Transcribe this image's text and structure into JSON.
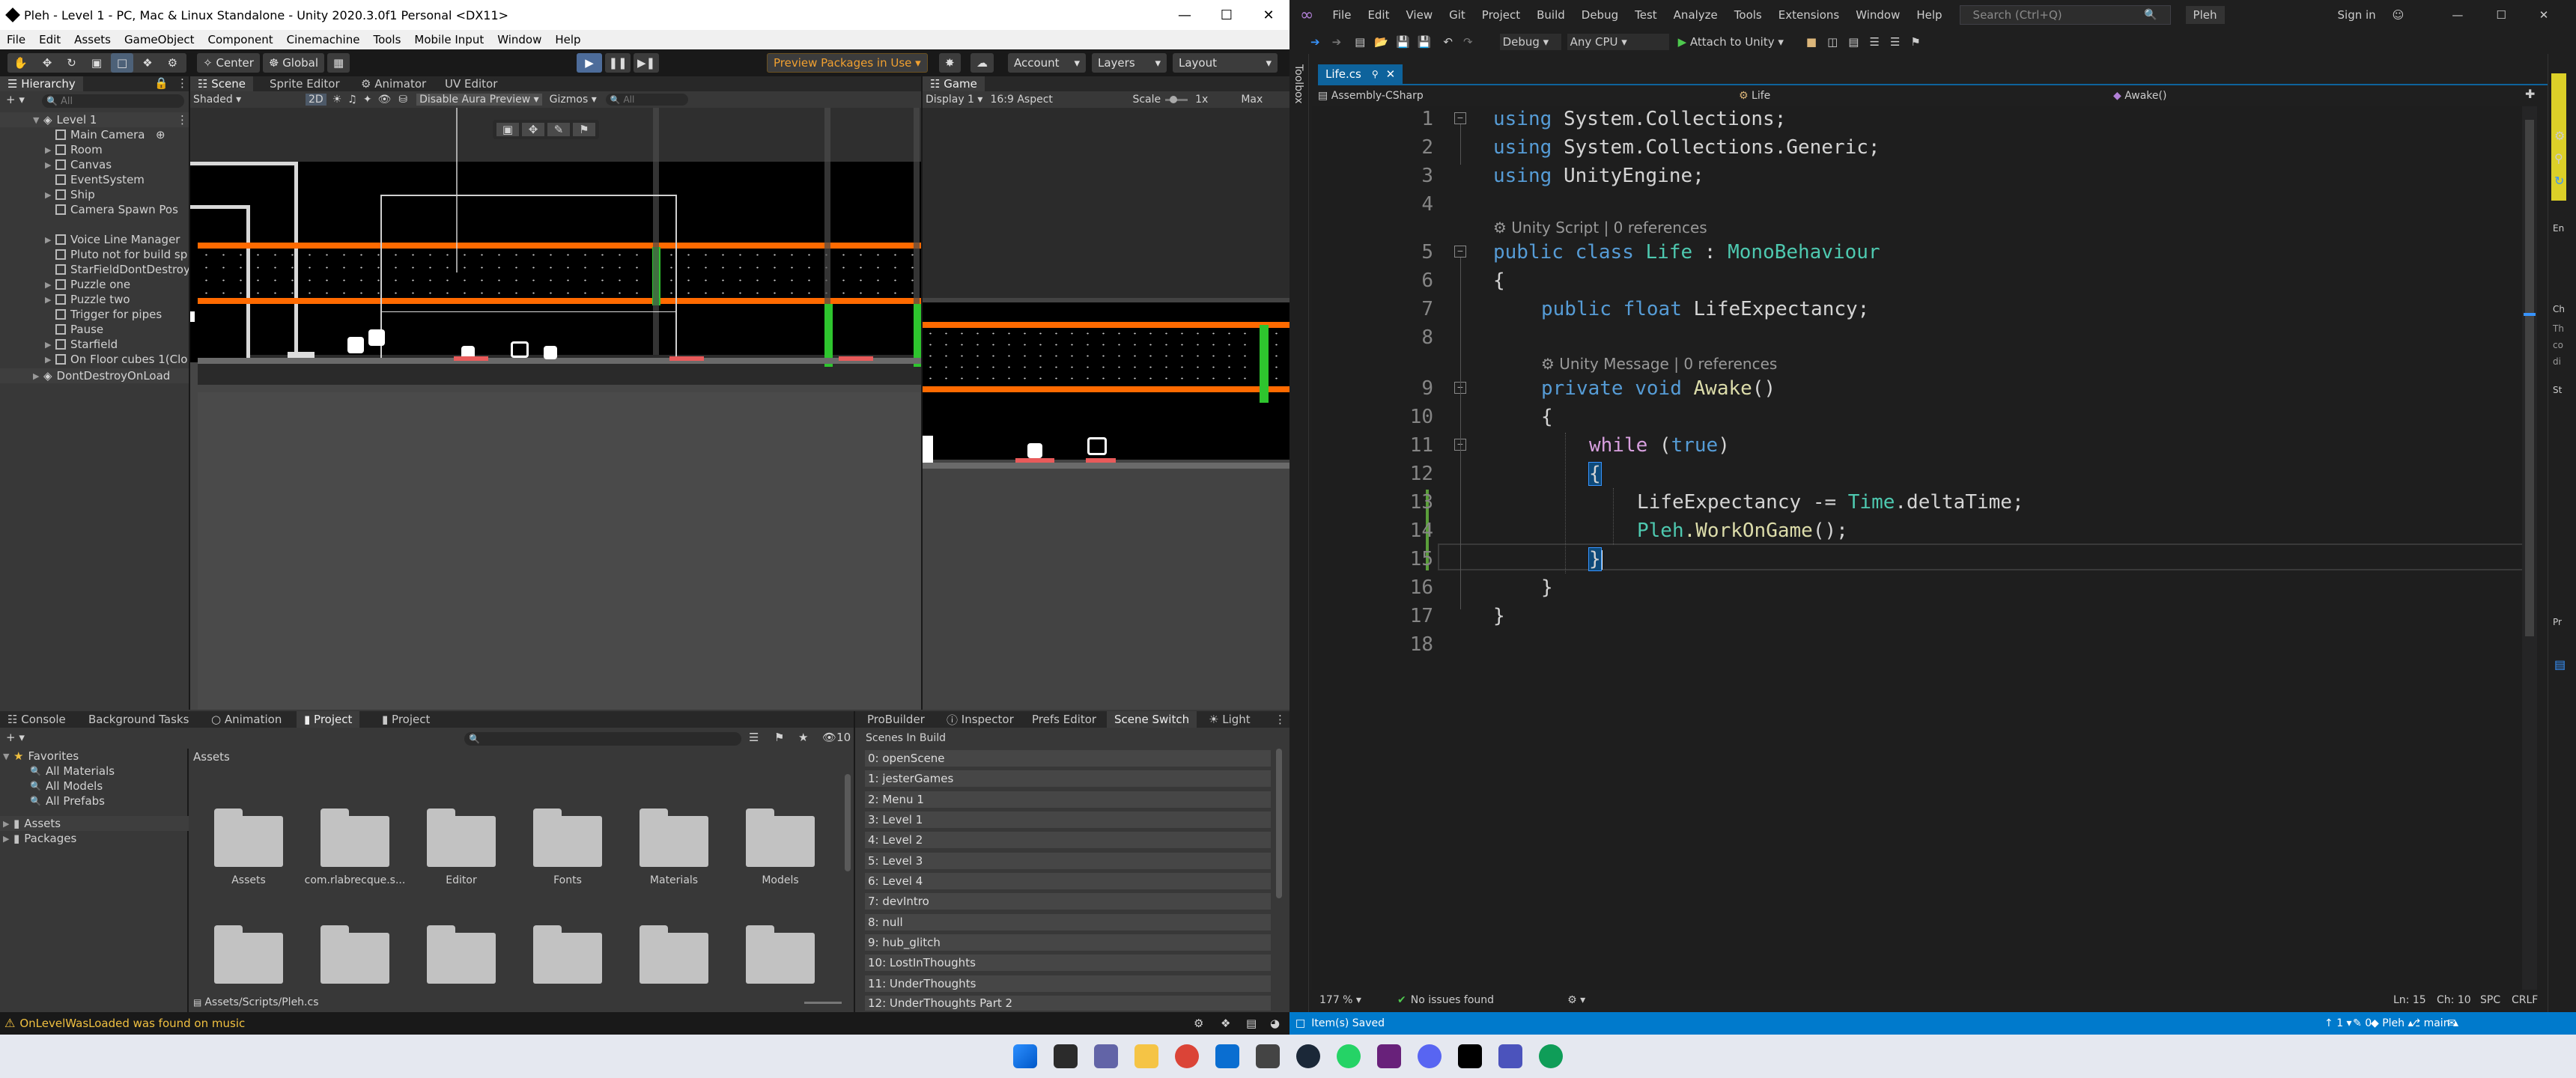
{
  "unity": {
    "title": "Pleh - Level 1 - PC, Mac & Linux Standalone - Unity 2020.3.0f1 Personal <DX11>",
    "menu": [
      "File",
      "Edit",
      "Assets",
      "GameObject",
      "Component",
      "Cinemachine",
      "Tools",
      "Mobile Input",
      "Window",
      "Help"
    ],
    "toolbar": {
      "center": "Center",
      "global": "Global",
      "packages": "Preview Packages in Use ▾",
      "account": "Account",
      "layers": "Layers",
      "layout": "Layout"
    },
    "hierarchy": {
      "tab": "Hierarchy",
      "search": "All",
      "items": [
        "Level 1",
        "Main Camera",
        "Room",
        "Canvas",
        "EventSystem",
        "Ship",
        "Camera Spawn Pos",
        "Voice Line Manager",
        "Pluto not for build sp",
        "StarFieldDontDestroy",
        "Puzzle one",
        "Puzzle two",
        "Trigger for pipes",
        "Pause",
        "Starfield",
        "On Floor cubes 1(Clo",
        "DontDestroyOnLoad"
      ]
    },
    "scene_tabs": [
      "Scene",
      "Sprite Editor",
      "Animator",
      "UV Editor"
    ],
    "scene_bar": {
      "shaded": "Shaded",
      "mode2d": "2D",
      "aura": "Disable Aura Preview",
      "gizmos": "Gizmos",
      "search": "All"
    },
    "game": {
      "tab": "Game",
      "display": "Display 1",
      "aspect": "16:9 Aspect",
      "scale": "Scale",
      "scale_val": "1x",
      "max": "Max"
    },
    "bottom_tabs": [
      "Console",
      "Background Tasks",
      "Animation",
      "Project",
      "Project"
    ],
    "favorites": {
      "label": "Favorites",
      "items": [
        "All Materials",
        "All Models",
        "All Prefabs"
      ]
    },
    "tree": [
      "Assets",
      "Packages"
    ],
    "assets_header": "Assets",
    "folders": [
      "Assets",
      "com.rlabrecque.s...",
      "Editor",
      "Fonts",
      "Materials",
      "Models"
    ],
    "path": "Assets/Scripts/Pleh.cs",
    "right_tabs": [
      "ProBuilder",
      "Inspector",
      "Prefs Editor",
      "Scene Switch",
      "Light"
    ],
    "scenes_header": "Scenes In Build",
    "scenes": [
      "0: openScene",
      "1: jesterGames",
      "2: Menu 1",
      "3: Level 1",
      "4: Level 2",
      "5: Level 3",
      "6: Level 4",
      "7: devIntro",
      "8: null",
      "9: hub_glitch",
      "10: LostInThoughts",
      "11: UnderThoughts",
      "12: UnderThoughts Part 2"
    ],
    "console_count": "10",
    "status": "OnLevelWasLoaded was found on music"
  },
  "vs": {
    "menu": [
      "File",
      "Edit",
      "View",
      "Git",
      "Project",
      "Build",
      "Debug",
      "Test",
      "Analyze",
      "Tools",
      "Extensions",
      "Window",
      "Help"
    ],
    "search": "Search (Ctrl+Q)",
    "solution": "Pleh",
    "signin": "Sign in",
    "config": "Debug",
    "platform": "Any CPU",
    "attach": "Attach to Unity",
    "toolbox": "Toolbox",
    "file_tab": "Life.cs",
    "nav": {
      "project": "Assembly-CSharp",
      "class": "Life",
      "member": "Awake()"
    },
    "lines": [
      "1",
      "2",
      "3",
      "4",
      "5",
      "6",
      "7",
      "8",
      "9",
      "10",
      "11",
      "12",
      "13",
      "14",
      "15",
      "16",
      "17",
      "18"
    ],
    "lens1": "Unity Script | 0 references",
    "lens2": "Unity Message | 0 references",
    "code": {
      "using": "using",
      "ns1": "System.Collections;",
      "ns2": "System.Collections.Generic;",
      "ns3": "UnityEngine;",
      "public": "public",
      "class": "class",
      "Life": "Life",
      "colon": ":",
      "Mono": "MonoBehaviour",
      "float": "float",
      "field": "LifeExpectancy;",
      "private": "private",
      "void": "void",
      "Awake": "Awake",
      "paren": "()",
      "while": "while",
      "true": "true",
      "le": "LifeExpectancy",
      "minus": "-=",
      "Time": "Time",
      "delta": ".deltaTime;",
      "Pleh": "Pleh",
      "work": ".WorkOnGame",
      "call": "();",
      "ob": "{",
      "cb": "}"
    },
    "zoom": "177 %",
    "issues": "No issues found",
    "status_saved": "Item(s) Saved",
    "ln": "Ln: 15",
    "ch": "Ch: 10",
    "spc": "SPC",
    "crlf": "CRLF",
    "up": "1",
    "pen": "0",
    "repo": "Pleh",
    "branch": "main"
  },
  "right_strip": [
    "En",
    "Ch",
    "Th",
    "co",
    "di",
    "St",
    "Pr"
  ]
}
